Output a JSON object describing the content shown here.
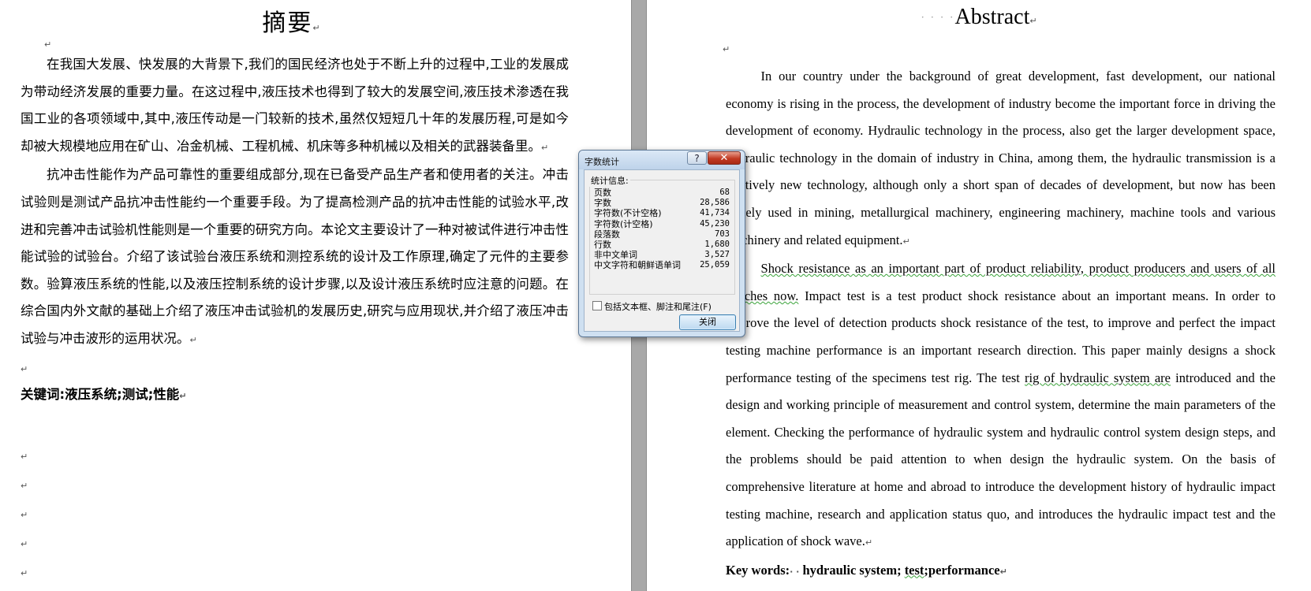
{
  "pilcrow": "↵",
  "chinese_page": {
    "title": "摘要",
    "paragraphs": [
      "在我国大发展、快发展的大背景下,我们的国民经济也处于不断上升的过程中,工业的发展成为带动经济发展的重要力量。在这过程中,液压技术也得到了较大的发展空间,液压技术渗透在我国工业的各项领域中,其中,液压传动是一门较新的技术,虽然仅短短几十年的发展历程,可是如今却被大规模地应用在矿山、冶金机械、工程机械、机床等多种机械以及相关的武器装备里。",
      "抗冲击性能作为产品可靠性的重要组成部分,现在已备受产品生产者和使用者的关注。冲击试验则是测试产品抗冲击性能约一个重要手段。为了提高检测产品的抗冲击性能的试验水平,改进和完善冲击试验机性能则是一个重要的研究方向。本论文主要设计了一种对被试件进行冲击性能试验的试验台。介绍了该试验台液压系统和测控系统的设计及工作原理,确定了元件的主要参数。验算液压系统的性能,以及液压控制系统的设计步骤,以及设计液压系统时应注意的问题。在综合国内外文献的基础上介绍了液压冲击试验机的发展历史,研究与应用现状,并介绍了液压冲击试验与冲击波形的运用状况。"
    ],
    "keywords": "关键词:液压系统;测试;性能"
  },
  "english_page": {
    "title": "Abstract",
    "title_dots": "· · · ·",
    "p1": "In our country under the background of great development, fast development, our national economy is rising in the process, the development of industry become the important force in driving the development of economy. Hydraulic technology in the process, also get the larger development space, hydraulic technology in the domain of industry in China, among them, the hydraulic transmission is a relatively new technology, although only a short span of decades of development, but now has been largely used in mining, metallurgical machinery, engineering machinery, machine tools and various machinery and related equipment.",
    "p2": {
      "s1": "Shock resistance as an important part of product reliability, product producers and users of all watches now.",
      "s2": " Impact test is a test product shock resistance about an important means. In order to improve the level of detection products shock resistance of the test, to improve and perfect the impact testing machine performance is an important research direction. This paper mainly designs a shock performance testing of the specimens test rig. The test ",
      "s3": "rig of hydraulic system are",
      "s4": " introduced and the design and working principle of measurement and control system, determine the main parameters of the element. Checking the performance of hydraulic system and hydraulic control system design steps, and the problems should be paid attention to when design the hydraulic system. On the basis of comprehensive literature at home and abroad to introduce the development history of hydraulic impact testing machine, research and application status quo, and introduces the hydraulic impact test and the application of shock wave."
    },
    "keywords_label": "Key words:",
    "keywords_dots": "· ·",
    "keywords_value": "hydraulic system; ",
    "keywords_test": "test",
    "keywords_rest": ";performance"
  },
  "dialog": {
    "title": "字数统计",
    "help_label": "?",
    "close_label": "✕",
    "group_label": "统计信息:",
    "stats": [
      {
        "label": "页数",
        "value": "68"
      },
      {
        "label": "字数",
        "value": "28,586"
      },
      {
        "label": "字符数(不计空格)",
        "value": "41,734"
      },
      {
        "label": "字符数(计空格)",
        "value": "45,230"
      },
      {
        "label": "段落数",
        "value": "703"
      },
      {
        "label": "行数",
        "value": "1,680"
      },
      {
        "label": "非中文单词",
        "value": "3,527"
      },
      {
        "label": "中文字符和朝鲜语单词",
        "value": "25,059"
      }
    ],
    "checkbox_label": "包括文本框、脚注和尾注(F)",
    "checkbox_checked": false,
    "ok_label": "关闭"
  }
}
